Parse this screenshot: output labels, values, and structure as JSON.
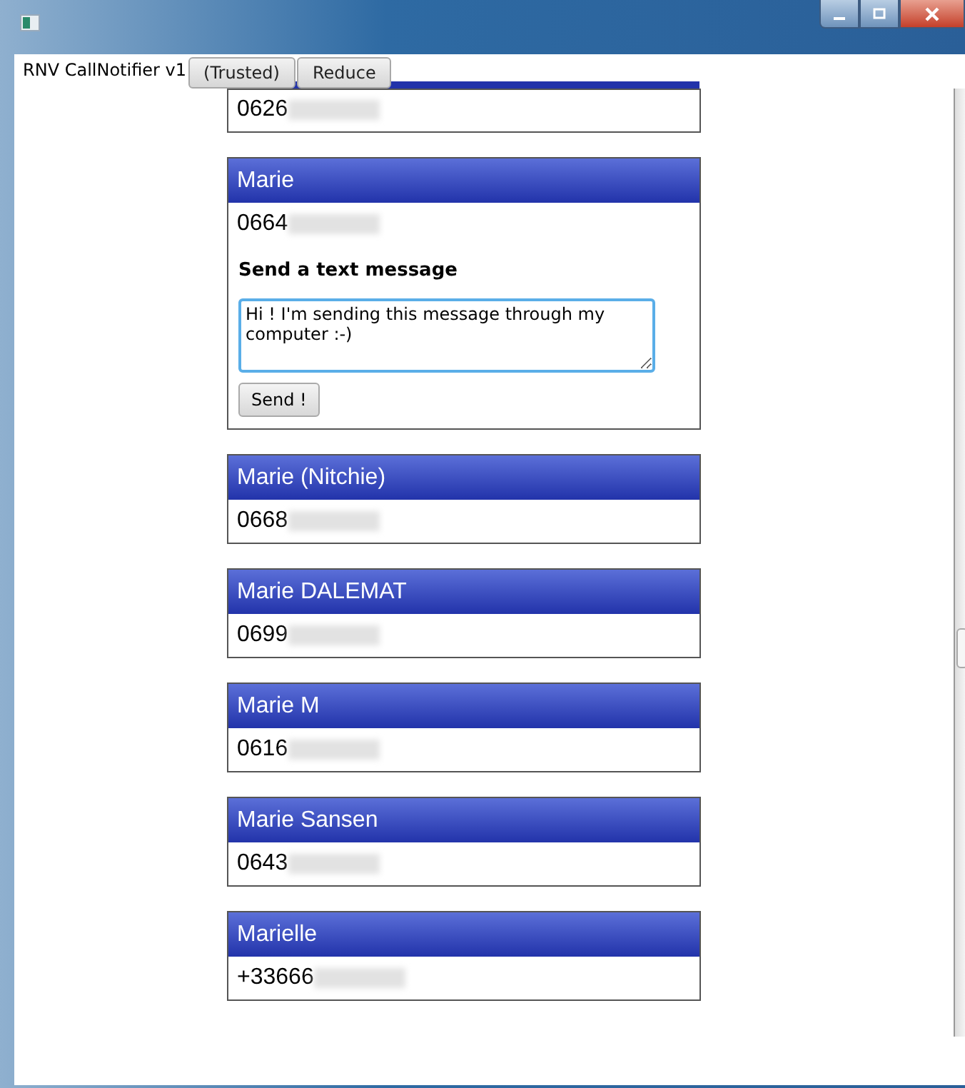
{
  "app_label": "RNV CallNotifier v1",
  "toolbar_buttons": [
    "(Trusted)",
    "Reduce"
  ],
  "contacts": [
    {
      "number": "0626"
    },
    {
      "name": "Marie",
      "number": "0664",
      "sms": {
        "heading": "Send a text message",
        "value": "Hi ! I'm sending this message through my computer :-)",
        "button": "Send !"
      }
    },
    {
      "name": "Marie (Nitchie)",
      "number": "0668"
    },
    {
      "name": "Marie DALEMAT",
      "number": "0699"
    },
    {
      "name": "Marie M",
      "number": "0616"
    },
    {
      "name": "Marie Sansen",
      "number": "0643"
    },
    {
      "name": "Marielle",
      "number": "+33666"
    }
  ]
}
